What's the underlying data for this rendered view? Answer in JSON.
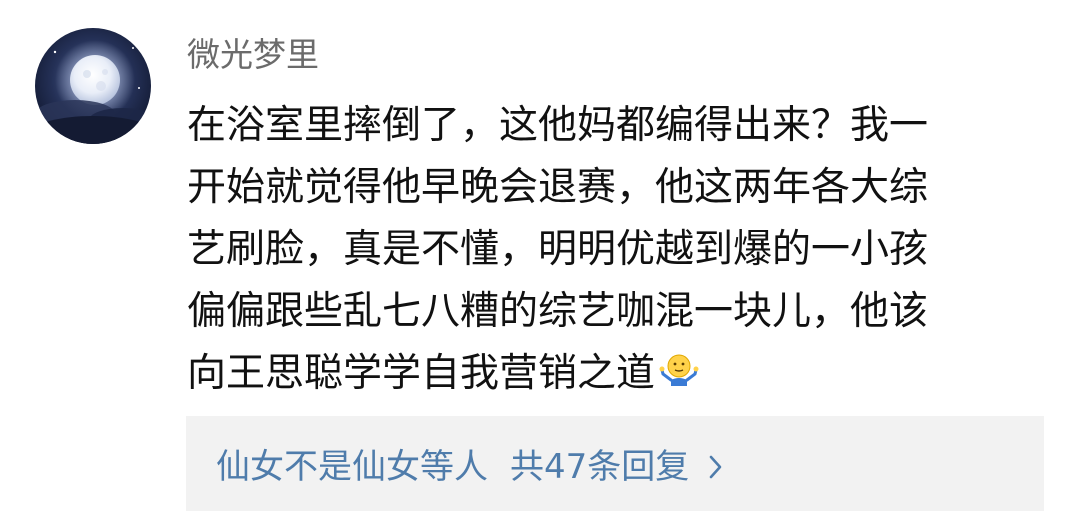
{
  "comment": {
    "username": "微光梦里",
    "lines": [
      "在浴室里摔倒了，这他妈都编得出来？我一",
      "开始就觉得他早晚会退赛，他这两年各大综",
      "艺刷脸，真是不懂，明明优越到爆的一小孩",
      "偏偏跟些乱七八糟的综艺咖混一块儿，他该",
      "向王思聪学学自我营销之道"
    ],
    "emoji": "shrug-emoji-icon",
    "avatar": "moon-night-avatar"
  },
  "replies": {
    "repliers": "仙女不是仙女等人",
    "count_text": "共47条回复",
    "chevron": "chevron-right-icon"
  },
  "colors": {
    "username": "#6b6b6b",
    "text": "#111111",
    "link": "#4f7cab",
    "reply_bg": "#f2f2f2"
  }
}
